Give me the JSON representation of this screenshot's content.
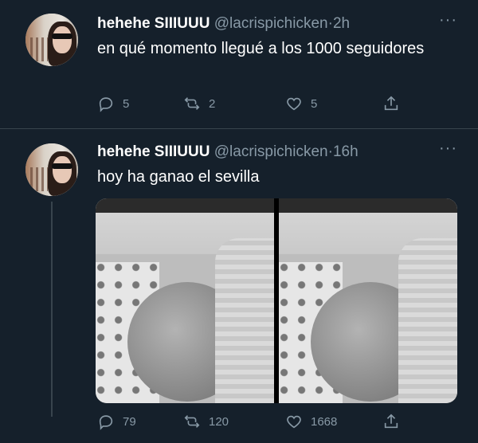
{
  "tweets": [
    {
      "name": "hehehe SIIIUUU",
      "handle": "@lacrispichicken",
      "separator": "·",
      "time": "2h",
      "text": "en qué momento llegué a los 1000 seguidores",
      "replies": "5",
      "retweets": "2",
      "likes": "5"
    },
    {
      "name": "hehehe SIIIUUU",
      "handle": "@lacrispichicken",
      "separator": "·",
      "time": "16h",
      "text": "hoy ha ganao el sevilla",
      "replies": "79",
      "retweets": "120",
      "likes": "1668"
    }
  ],
  "more_label": "···",
  "icons": {
    "reply": "reply-icon",
    "retweet": "retweet-icon",
    "like": "heart-icon",
    "share": "share-icon"
  },
  "colors": {
    "background": "#15202b",
    "secondary_text": "#8899a6",
    "divider": "#38444d"
  }
}
